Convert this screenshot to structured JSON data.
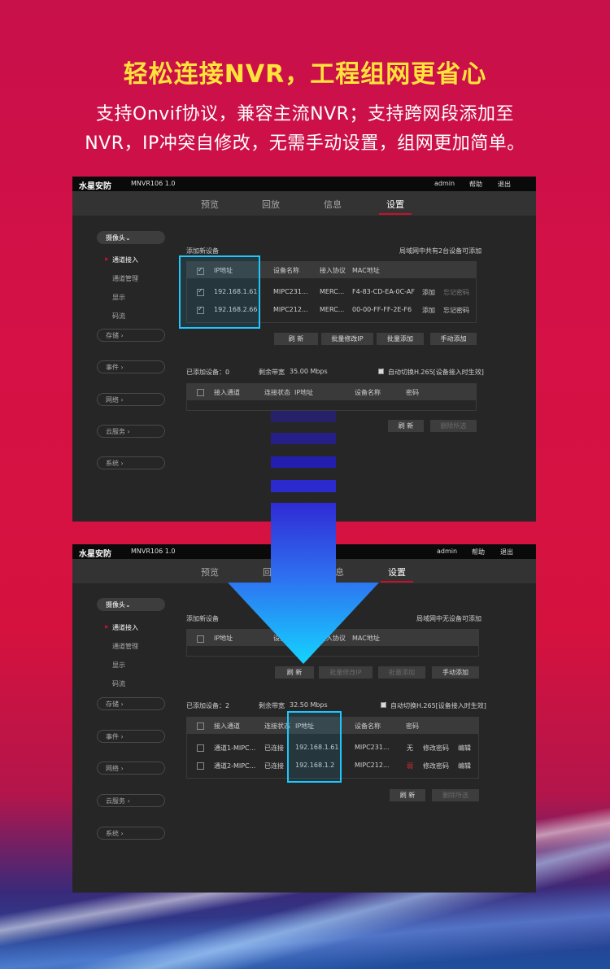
{
  "headline": "轻松连接NVR，工程组网更省心",
  "subtitle_line1": "支持Onvif协议，兼容主流NVR；支持跨网段添加至",
  "subtitle_line2": "NVR，IP冲突自修改，无需手动设置，组网更加简单。",
  "common": {
    "brand": "水星安防",
    "model": "MNVR106 1.0",
    "user": "admin",
    "help": "帮助",
    "logout": "退出",
    "nav": [
      "预览",
      "回放",
      "信息",
      "设置"
    ],
    "sidebar": {
      "camera": "摄像头",
      "camera_items": [
        "通道接入",
        "通道管理",
        "显示",
        "码流"
      ],
      "groups": [
        "存储",
        "事件",
        "网络",
        "云服务",
        "系统"
      ]
    },
    "add_new_device": "添加新设备",
    "add_cols": [
      "IP地址",
      "设备名称",
      "接入协议",
      "MAC地址"
    ],
    "buttons": [
      "刷 新",
      "批量修改IP",
      "批量添加",
      "手动添加"
    ],
    "added_cols": [
      "接入通道",
      "连接状态",
      "IP地址",
      "设备名称",
      "密码"
    ],
    "bottom_buttons": [
      "刷 新",
      "删除所选"
    ],
    "auto_switch": "自动切换H.265[设备接入时生效]",
    "bandwidth_label": "剩余带宽"
  },
  "panel1": {
    "lan_info": "局域网中共有2台设备可添加",
    "added_count": "已添加设备：0",
    "bandwidth": "35.00 Mbps",
    "devices": [
      {
        "ip": "192.168.1.61",
        "name": "MIPC231...",
        "protocol": "MERC...",
        "mac": "F4-83-CD-EA-0C-AF",
        "add": "添加",
        "forgot": "忘记密码"
      },
      {
        "ip": "192.168.2.66",
        "name": "MIPC212...",
        "protocol": "MERC...",
        "mac": "00-00-FF-FF-2E-F6",
        "add": "添加",
        "forgot": "忘记密码"
      }
    ]
  },
  "panel2": {
    "lan_info": "局域网中无设备可添加",
    "added_count": "已添加设备：2",
    "bandwidth": "32.50 Mbps",
    "channels": [
      {
        "channel": "通道1-MIPC...",
        "status": "已连接",
        "ip": "192.168.1.61",
        "name": "MIPC231...",
        "password": "无",
        "modify": "修改密码",
        "edit": "编辑"
      },
      {
        "channel": "通道2-MIPC...",
        "status": "已连接",
        "ip": "192.168.1.2",
        "name": "MIPC212...",
        "password": "弱",
        "modify": "修改密码",
        "edit": "编辑"
      }
    ]
  },
  "colors": {
    "headline": "#ffe33a",
    "highlight": "#1cc8ff",
    "accent": "#c8102e"
  }
}
